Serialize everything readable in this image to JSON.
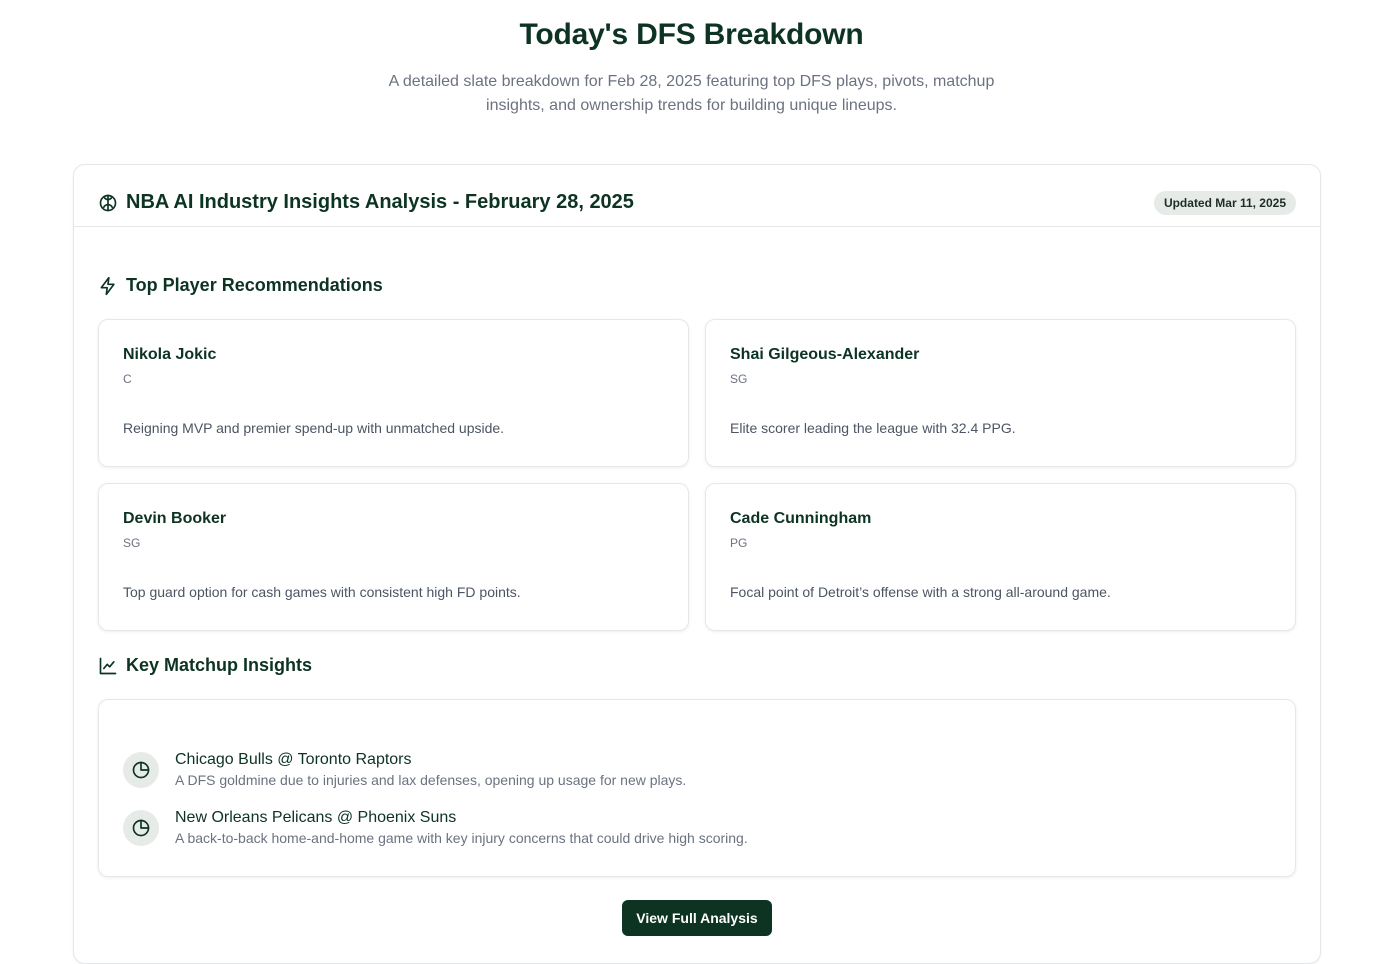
{
  "hero": {
    "title": "Today's DFS Breakdown",
    "subtitle": "A detailed slate breakdown for Feb 28, 2025 featuring top DFS plays, pivots, matchup insights, and ownership trends for building unique lineups."
  },
  "analysis": {
    "title": "NBA AI Industry Insights Analysis - February 28, 2025",
    "updated": "Updated Mar 11, 2025",
    "icon": "brain-icon"
  },
  "players_section": {
    "title": "Top Player Recommendations",
    "icon": "lightning-icon",
    "players": [
      {
        "name": "Nikola Jokic",
        "position": "C",
        "description": "Reigning MVP and premier spend-up with unmatched upside."
      },
      {
        "name": "Shai Gilgeous-Alexander",
        "position": "SG",
        "description": "Elite scorer leading the league with 32.4 PPG."
      },
      {
        "name": "Devin Booker",
        "position": "SG",
        "description": "Top guard option for cash games with consistent high FD points."
      },
      {
        "name": "Cade Cunningham",
        "position": "PG",
        "description": "Focal point of Detroit’s offense with a strong all-around game."
      }
    ]
  },
  "matchups_section": {
    "title": "Key Matchup Insights",
    "icon": "line-chart-icon",
    "matchups": [
      {
        "title": "Chicago Bulls @ Toronto Raptors",
        "description": "A DFS goldmine due to injuries and lax defenses, opening up usage for new plays."
      },
      {
        "title": "New Orleans Pelicans @ Phoenix Suns",
        "description": "A back-to-back home-and-home game with key injury concerns that could drive high scoring."
      }
    ]
  },
  "cta_label": "View Full Analysis",
  "colors": {
    "primary": "#0d3323",
    "muted": "#6b7280",
    "badge_bg": "#e7ebe8"
  }
}
